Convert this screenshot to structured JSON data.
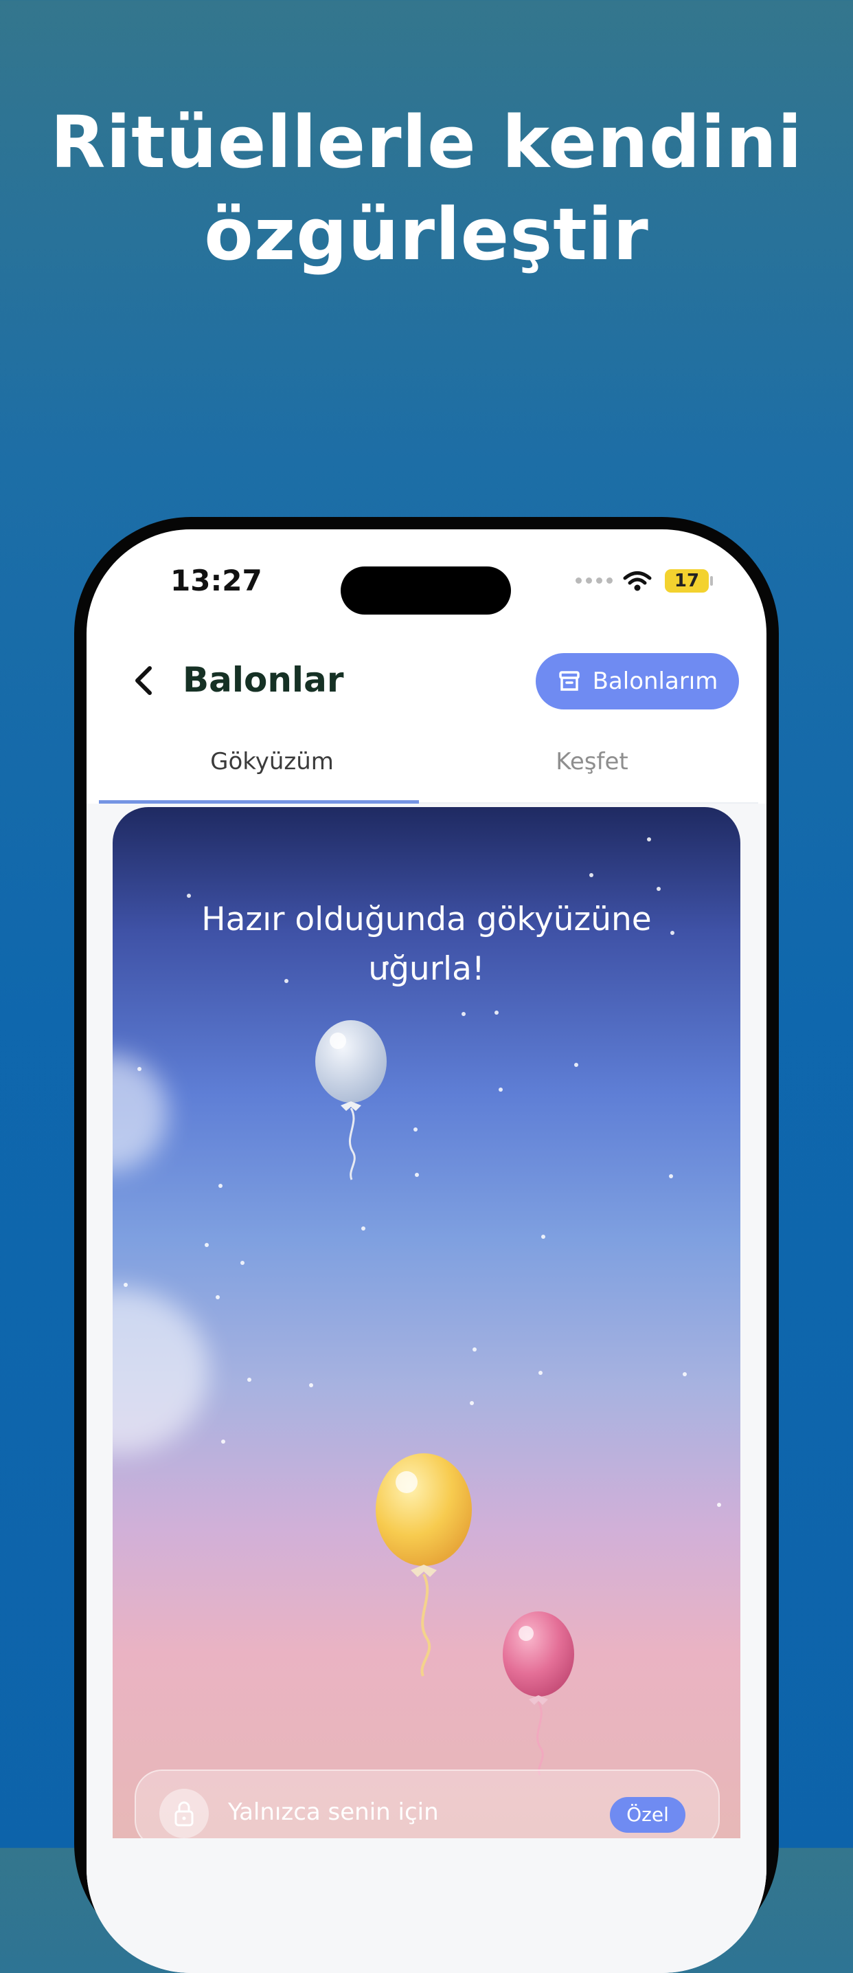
{
  "headline": {
    "line1": "Ritüellerle kendini",
    "line2": "özgürleştir"
  },
  "status_bar": {
    "time": "13:27",
    "battery": "17"
  },
  "nav": {
    "title": "Balonlar",
    "action_label": "Balonlarım"
  },
  "tabs": [
    {
      "label": "Gökyüzüm",
      "active": true
    },
    {
      "label": "Keşfet",
      "active": false
    }
  ],
  "sky": {
    "message_line1": "Hazır olduğunda gökyüzüne",
    "message_line2": "uğurla!"
  },
  "balloons": [
    {
      "name": "white",
      "color": "#c9d6ea"
    },
    {
      "name": "yellow",
      "color": "#f6c84a"
    },
    {
      "name": "pink",
      "color": "#e46f97"
    }
  ],
  "privacy": {
    "label": "Yalnızca senin için",
    "badge": "Özel"
  },
  "colors": {
    "accent": "#6f8bf2",
    "title": "#163125"
  }
}
